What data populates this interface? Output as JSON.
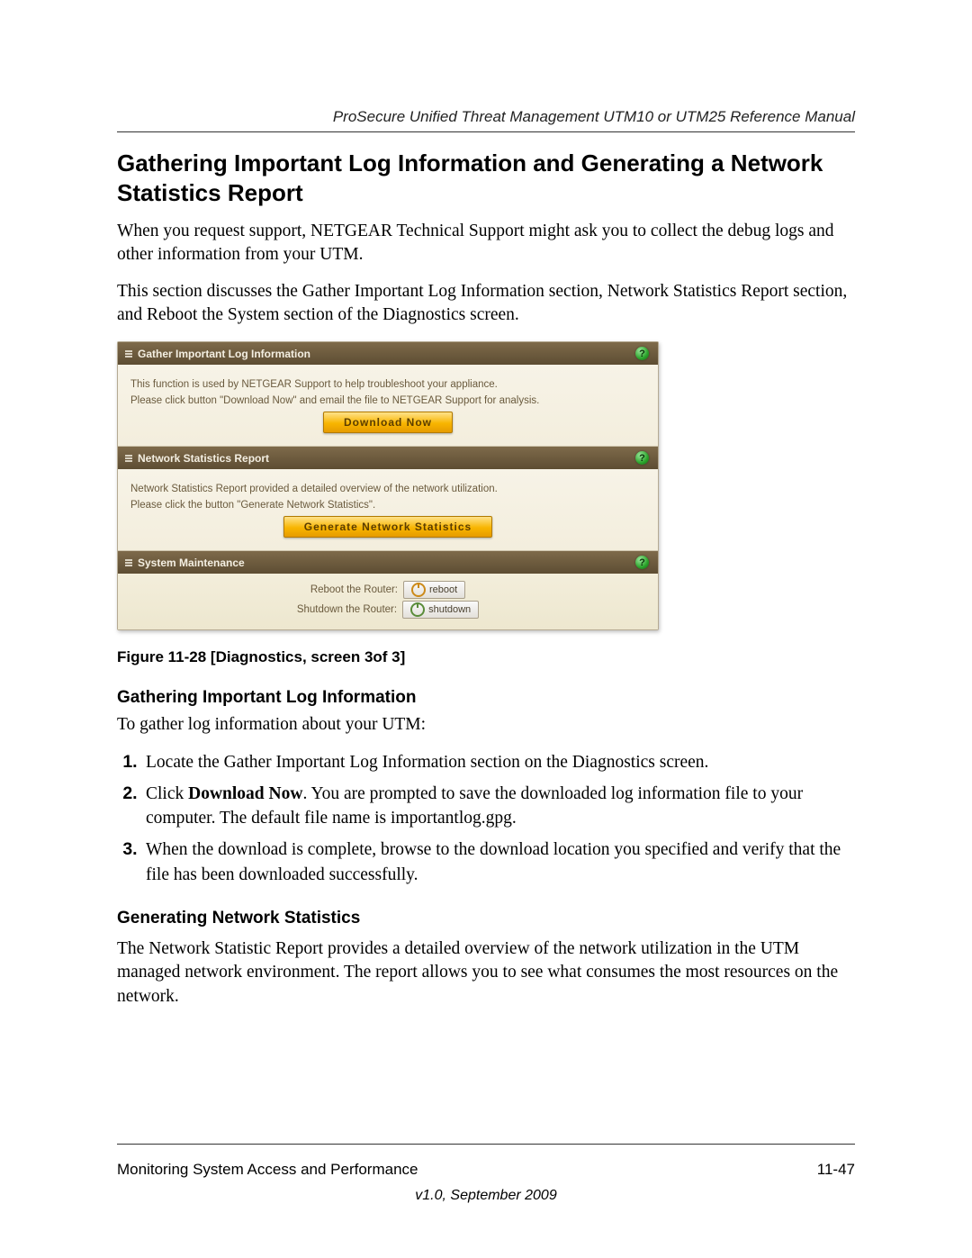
{
  "header": {
    "running_head": "ProSecure Unified Threat Management UTM10 or UTM25 Reference Manual"
  },
  "title": "Gathering Important Log Information and Generating a Network Statistics Report",
  "paragraphs": {
    "intro1": "When you request support, NETGEAR Technical Support might ask you to collect the debug logs and other information from your UTM.",
    "intro2": "This section discusses the Gather Important Log Information section, Network Statistics Report section, and Reboot the System section of the Diagnostics screen."
  },
  "figure": {
    "panel_log": {
      "title": "Gather Important Log Information",
      "line1": "This function is used by NETGEAR Support to help troubleshoot your appliance.",
      "line2": "Please click button \"Download Now\" and email the file to NETGEAR Support for analysis.",
      "button": "Download Now"
    },
    "panel_stats": {
      "title": "Network Statistics Report",
      "line1": "Network Statistics Report provided a detailed overview of the network utilization.",
      "line2": "Please click the button \"Generate Network Statistics\".",
      "button": "Generate Network Statistics"
    },
    "panel_maint": {
      "title": "System Maintenance",
      "reboot_label": "Reboot the Router:",
      "reboot_btn": "reboot",
      "shutdown_label": "Shutdown the Router:",
      "shutdown_btn": "shutdown"
    },
    "help_glyph": "?",
    "caption": "Figure 11-28 [Diagnostics, screen 3of 3]"
  },
  "sub1": {
    "heading": "Gathering Important Log Information",
    "lead": "To gather log information about your UTM:",
    "steps": {
      "s1": "Locate the Gather Important Log Information section on the Diagnostics screen.",
      "s2a": "Click ",
      "s2b": "Download Now",
      "s2c": ". You are prompted to save the downloaded log information file to your computer. The default file name is importantlog.gpg.",
      "s3": "When the download is complete, browse to the download location you specified and verify that the file has been downloaded successfully."
    }
  },
  "sub2": {
    "heading": "Generating Network Statistics",
    "para": "The Network Statistic Report provides a detailed overview of the network utilization in the UTM managed network environment. The report allows you to see what consumes the most resources on the network."
  },
  "footer": {
    "left": "Monitoring System Access and Performance",
    "right": "11-47",
    "version": "v1.0, September 2009"
  }
}
